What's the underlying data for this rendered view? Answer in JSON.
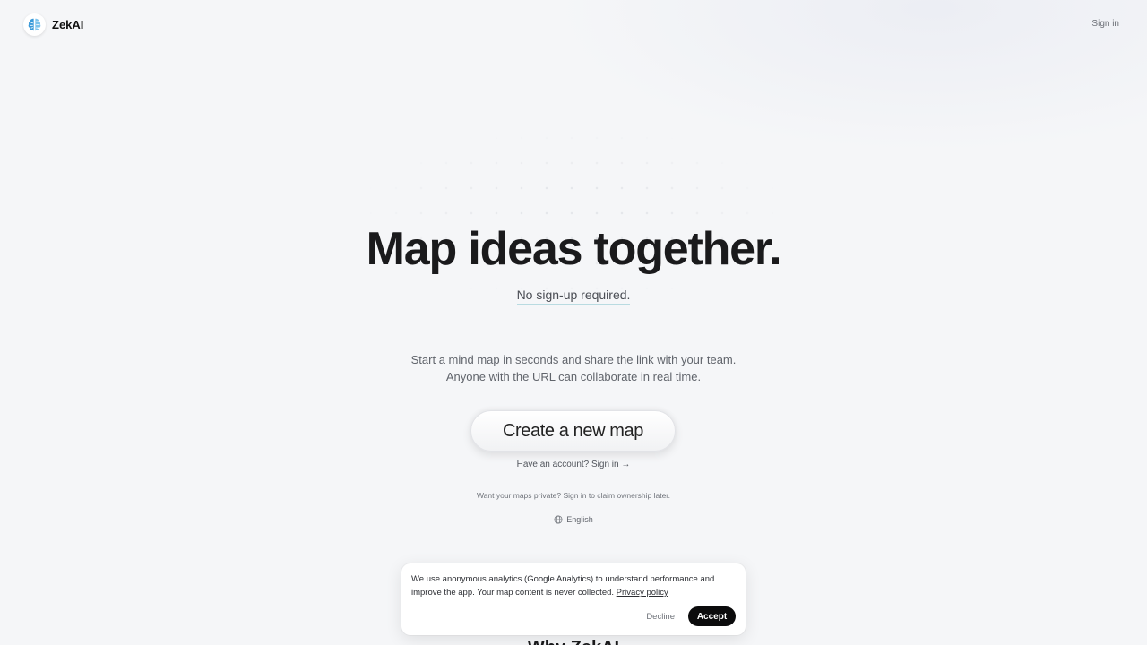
{
  "header": {
    "brand_name": "ZekAI",
    "signin_label": "Sign in",
    "logo_icon": "brain-icon"
  },
  "hero": {
    "title": "Map ideas together.",
    "tagline": "No sign-up required.",
    "description_line1": "Start a mind map in seconds and share the link with your team.",
    "description_line2": "Anyone with the URL can collaborate in real time.",
    "cta_label": "Create a new map",
    "account_prompt": "Have an account?",
    "account_signin": "Sign in →",
    "private_note": "Want your maps private? Sign in to claim ownership later.",
    "language": "English"
  },
  "section": {
    "partial_heading": "Why ZekAI"
  },
  "cookie_banner": {
    "text": "We use anonymous analytics (Google Analytics) to understand performance and improve the app. Your map content is never collected.",
    "privacy_link": "Privacy policy",
    "decline_label": "Decline",
    "accept_label": "Accept"
  },
  "colors": {
    "background": "#f5f6f8",
    "accept_button": "#0b0b0c",
    "tagline_underline": "#b9dbe1",
    "logo_accent": "#3a9ad9"
  }
}
